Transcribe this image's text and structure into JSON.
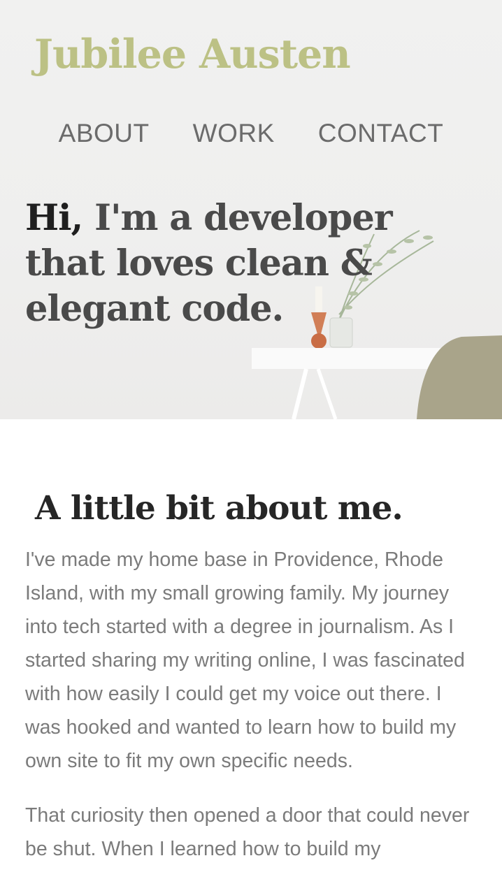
{
  "site": {
    "brand": "Jubilee Austen"
  },
  "nav": {
    "items": [
      "ABOUT",
      "WORK",
      "CONTACT"
    ]
  },
  "hero": {
    "headline_hi": "Hi,",
    "headline_rest": " I'm a developer that loves clean & elegant code."
  },
  "about": {
    "heading": "A little bit about me.",
    "paragraphs": [
      "I've made my home base in Providence, Rhode Island, with my small growing family. My journey into tech started with a degree in journalism. As I started sharing my writing online, I was fascinated with how easily I could get my voice out there. I was hooked and wanted to learn how to build my own site to fit my own specific needs.",
      "That curiosity then opened a door that could never be shut. When I learned how to build my"
    ]
  },
  "colors": {
    "brand": "#bcc185",
    "headline": "#4a4a4a",
    "body_text": "#7b7b7b"
  }
}
